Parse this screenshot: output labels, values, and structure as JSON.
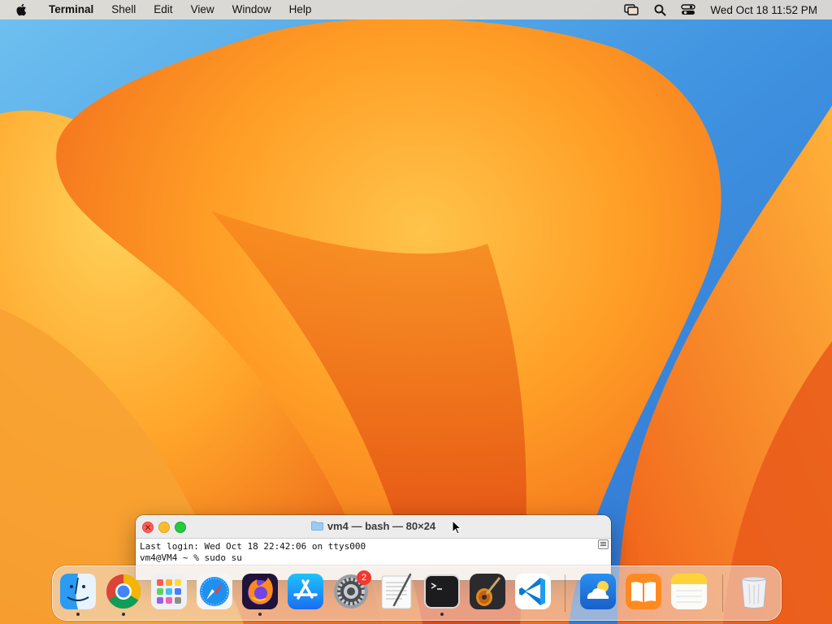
{
  "menubar": {
    "app_name": "Terminal",
    "menus": [
      "Shell",
      "Edit",
      "View",
      "Window",
      "Help"
    ],
    "clock": "Wed Oct 18  11:52 PM"
  },
  "terminal": {
    "title": "vm4 — bash — 80×24",
    "lines": [
      "Last login: Wed Oct 18 22:42:06 on ttys000",
      "vm4@VM4 ~ % sudo su"
    ]
  },
  "dock": {
    "apps": [
      {
        "name": "Finder",
        "running": true
      },
      {
        "name": "Google Chrome",
        "running": true
      },
      {
        "name": "Launchpad",
        "running": false
      },
      {
        "name": "Safari",
        "running": false
      },
      {
        "name": "Firefox",
        "running": true
      },
      {
        "name": "App Store",
        "running": false
      },
      {
        "name": "System Settings",
        "running": false,
        "badge": "2"
      },
      {
        "name": "TextEdit",
        "running": false
      },
      {
        "name": "Terminal",
        "running": true
      },
      {
        "name": "GarageBand",
        "running": false
      },
      {
        "name": "Visual Studio Code",
        "running": false
      },
      {
        "name": "Weather",
        "running": false
      },
      {
        "name": "Books",
        "running": false
      },
      {
        "name": "Notes",
        "running": false
      },
      {
        "name": "Trash",
        "running": false
      }
    ]
  },
  "colors": {
    "accent_orange": "#f58a1f",
    "sky_blue": "#3a8fdf",
    "close": "#ff5f57",
    "minimize": "#febc2e",
    "maximize": "#28c840",
    "badge": "#f2382f"
  }
}
